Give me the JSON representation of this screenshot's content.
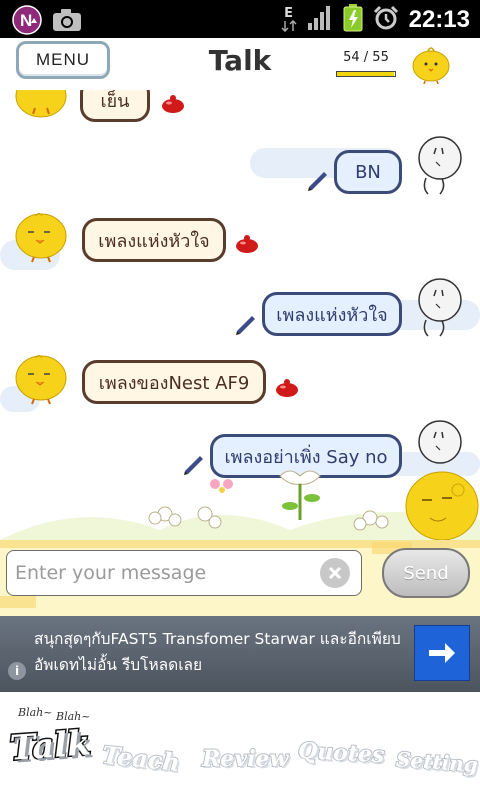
{
  "status_bar": {
    "time": "22:13",
    "network_label": "E",
    "icons": [
      "notification-n-icon",
      "camera-icon",
      "network-e-icon",
      "signal-icon",
      "battery-charging-icon",
      "alarm-icon"
    ]
  },
  "header": {
    "menu_label": "MENU",
    "title": "Talk",
    "counter": "54 / 55",
    "counter_fraction": 0.98
  },
  "chat": {
    "messages": [
      {
        "side": "left",
        "text": "เย็น"
      },
      {
        "side": "right",
        "text": "BN"
      },
      {
        "side": "left",
        "text": "เพลงแห่งหัวใจ"
      },
      {
        "side": "right",
        "text": "เพลงแห่งหัวใจ"
      },
      {
        "side": "left",
        "text": "เพลงของNest AF9"
      },
      {
        "side": "right",
        "text": "เพลงอย่าเพิ่ง Say no"
      }
    ]
  },
  "input": {
    "placeholder": "Enter your message",
    "value": "",
    "send_label": "Send"
  },
  "ad": {
    "text": "สนุกสุดๆกับFAST5 Transfomer Starwar และอีกเพียบอัพเดทไม่อั้น รีบโหลดเลย",
    "info_label": "i"
  },
  "tabs": {
    "blah1": "Blah~",
    "blah2": "Blah~",
    "items": [
      "Talk",
      "Teach",
      "Review",
      "Quotes",
      "Setting"
    ]
  },
  "colors": {
    "chick_yellow": "#f7d21a",
    "left_bubble_bg": "#fff6e4",
    "right_bubble_bg": "#e4efff",
    "ad_button": "#1f63d8"
  }
}
